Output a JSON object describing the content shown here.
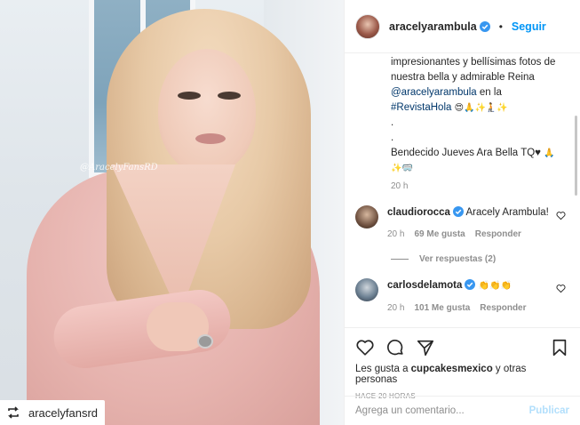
{
  "photo": {
    "watermark": "@AracelyFansRD",
    "repost_user": "aracelyfansrd"
  },
  "header": {
    "username": "aracelyarambula",
    "separator": "•",
    "follow_label": "Seguir"
  },
  "caption": {
    "line1": "impresionantes y bellísimas fotos de nuestra bella y admirable Reina",
    "mention": "@aracelyarambula",
    "after_mention": " en la",
    "hashtag": "#RevistaHola",
    "emojis1": " 😍🙏✨🧎✨",
    "dot1": ".",
    "dot2": ".",
    "line_final": "Bendecido Jueves Ara Bella TQ♥",
    "emojis2": " 🙏",
    "emojis3": "✨🥽",
    "time": "20 h"
  },
  "comments": [
    {
      "user": "claudiorocca",
      "text": "Aracely Arambula!",
      "time": "20 h",
      "likes": "69 Me gusta",
      "reply": "Responder",
      "view_replies": "Ver respuestas (2)"
    },
    {
      "user": "carlosdelamota",
      "text": "👏👏👏",
      "time": "20 h",
      "likes": "101 Me gusta",
      "reply": "Responder"
    }
  ],
  "actions": {
    "likes_prefix": "Les gusta a ",
    "likes_user": "cupcakesmexico",
    "likes_suffix": " y otras personas",
    "age": "HACE 20 HORAS"
  },
  "add_comment": {
    "placeholder": "Agrega un comentario...",
    "publish": "Publicar"
  },
  "colors": {
    "link_blue": "#0095f6",
    "verified_blue": "#3897f0",
    "muted": "#8e8e8e"
  }
}
